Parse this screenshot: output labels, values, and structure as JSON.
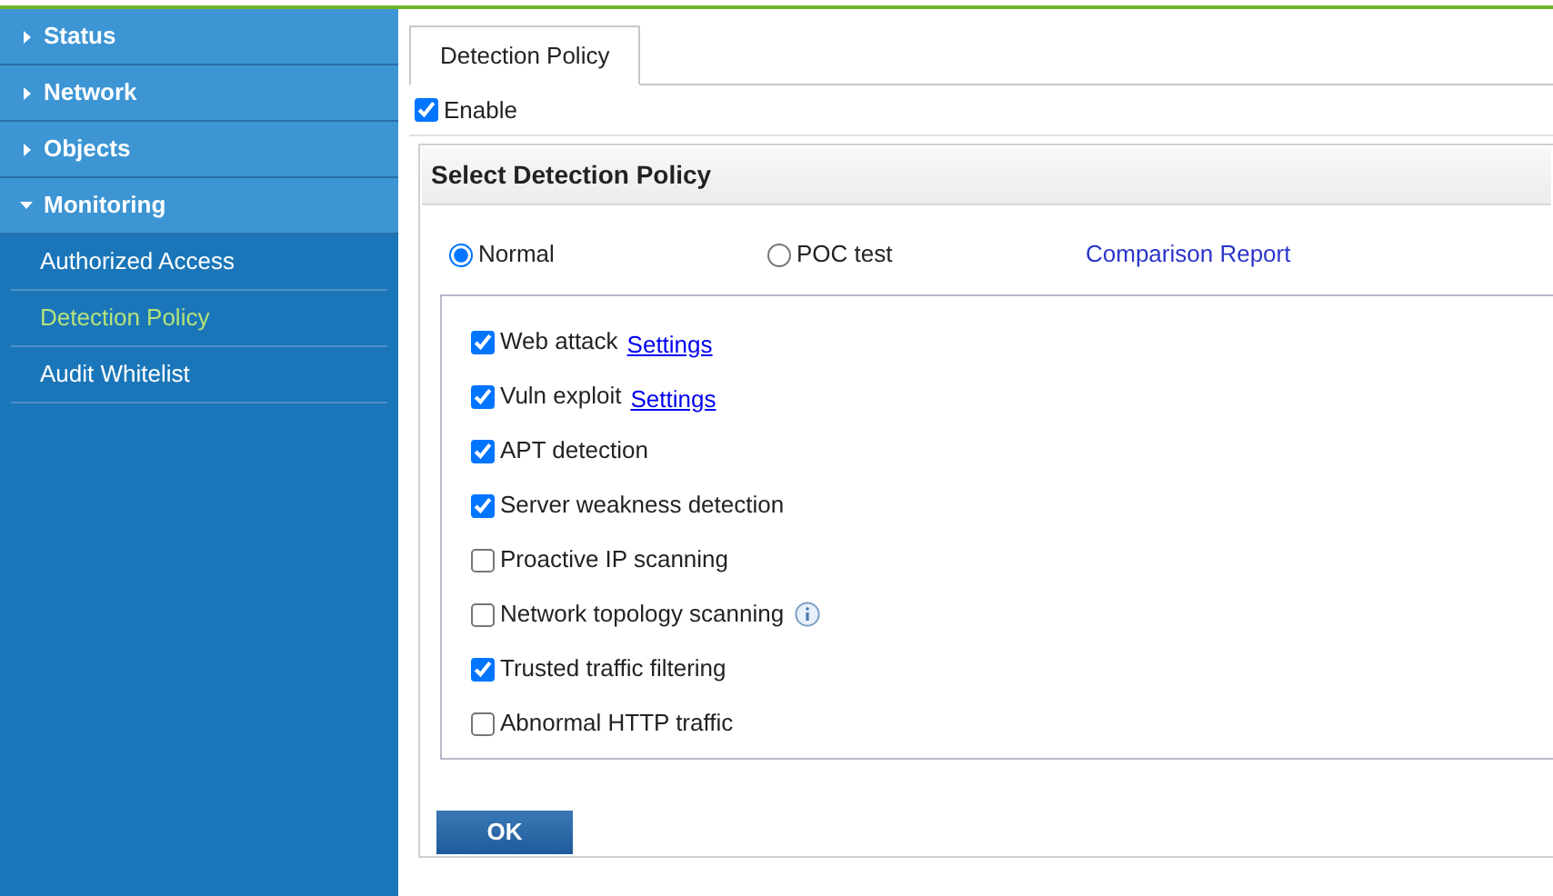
{
  "sidebar": {
    "items": [
      {
        "label": "Status",
        "expanded": false
      },
      {
        "label": "Network",
        "expanded": false
      },
      {
        "label": "Objects",
        "expanded": false
      },
      {
        "label": "Monitoring",
        "expanded": true,
        "children": [
          {
            "label": "Authorized Access",
            "selected": false
          },
          {
            "label": "Detection Policy",
            "selected": true
          },
          {
            "label": "Audit Whitelist",
            "selected": false
          }
        ]
      }
    ]
  },
  "tabs": [
    {
      "label": "Detection Policy",
      "selected": true
    }
  ],
  "enable": {
    "label": "Enable",
    "checked": true
  },
  "panel": {
    "title": "Select Detection Policy",
    "modes": [
      {
        "label": "Normal",
        "selected": true
      },
      {
        "label": "POC test",
        "selected": false
      }
    ],
    "report_link": "Comparison Report",
    "options": [
      {
        "label": "Web attack",
        "checked": true,
        "link": "Settings"
      },
      {
        "label": "Vuln exploit",
        "checked": true,
        "link": "Settings"
      },
      {
        "label": "APT detection",
        "checked": true
      },
      {
        "label": "Server weakness detection",
        "checked": true
      },
      {
        "label": "Proactive IP scanning",
        "checked": false
      },
      {
        "label": "Network topology scanning",
        "checked": false,
        "info": true
      },
      {
        "label": "Trusted traffic filtering",
        "checked": true
      },
      {
        "label": "Abnormal HTTP traffic",
        "checked": false
      }
    ]
  },
  "ok_button": "OK"
}
